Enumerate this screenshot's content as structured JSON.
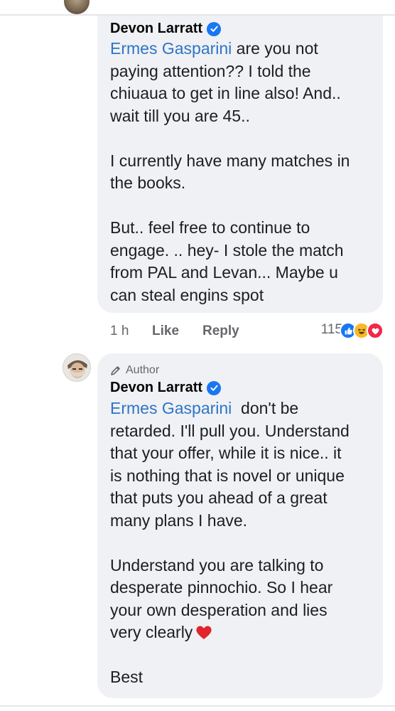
{
  "comment1": {
    "author_name": "Devon Larratt",
    "mention": "Ermes Gasparini",
    "line1_rest": " are you not",
    "line2": "paying attention?? I told the",
    "line3": "chiuaua to get in line also! And..",
    "line4": "wait till you are 45..",
    "para2_line1": "I currently have many matches in",
    "para2_line2": "the books.",
    "para3_line1": "But.. feel free to continue to",
    "para3_line2": "engage. .. hey- I stole the match",
    "para3_line3": "from PAL and Levan... Maybe u",
    "para3_line4": "can steal engins spot"
  },
  "actions": {
    "time": "1 h",
    "like_label": "Like",
    "reply_label": "Reply",
    "reaction_count": "115"
  },
  "comment2": {
    "badge": "Author",
    "author_name": "Devon Larratt",
    "mention": "Ermes Gasparini",
    "line1_rest": "  don't be",
    "line2": "retarded. I'll pull you. Understand",
    "line3": "that your offer, while it is nice.. it",
    "line4": "is nothing that is novel or unique",
    "line5": "that puts you ahead of a great",
    "line6": "many plans I have.",
    "para2_line1": "Understand you are talking to",
    "para2_line2": "desperate pinnochio. So I hear",
    "para2_line3": "your own desperation and lies",
    "para2_line4": "very clearly",
    "closing": "Best"
  },
  "colors": {
    "bubble": "#eff1f4",
    "mention": "#2f74c4",
    "verified": "#1877f2",
    "heart": "#e0252c"
  },
  "icons": [
    "verified-badge-icon",
    "pencil-icon",
    "like-reaction-icon",
    "haha-reaction-icon",
    "love-reaction-icon",
    "heart-emoji-icon"
  ]
}
